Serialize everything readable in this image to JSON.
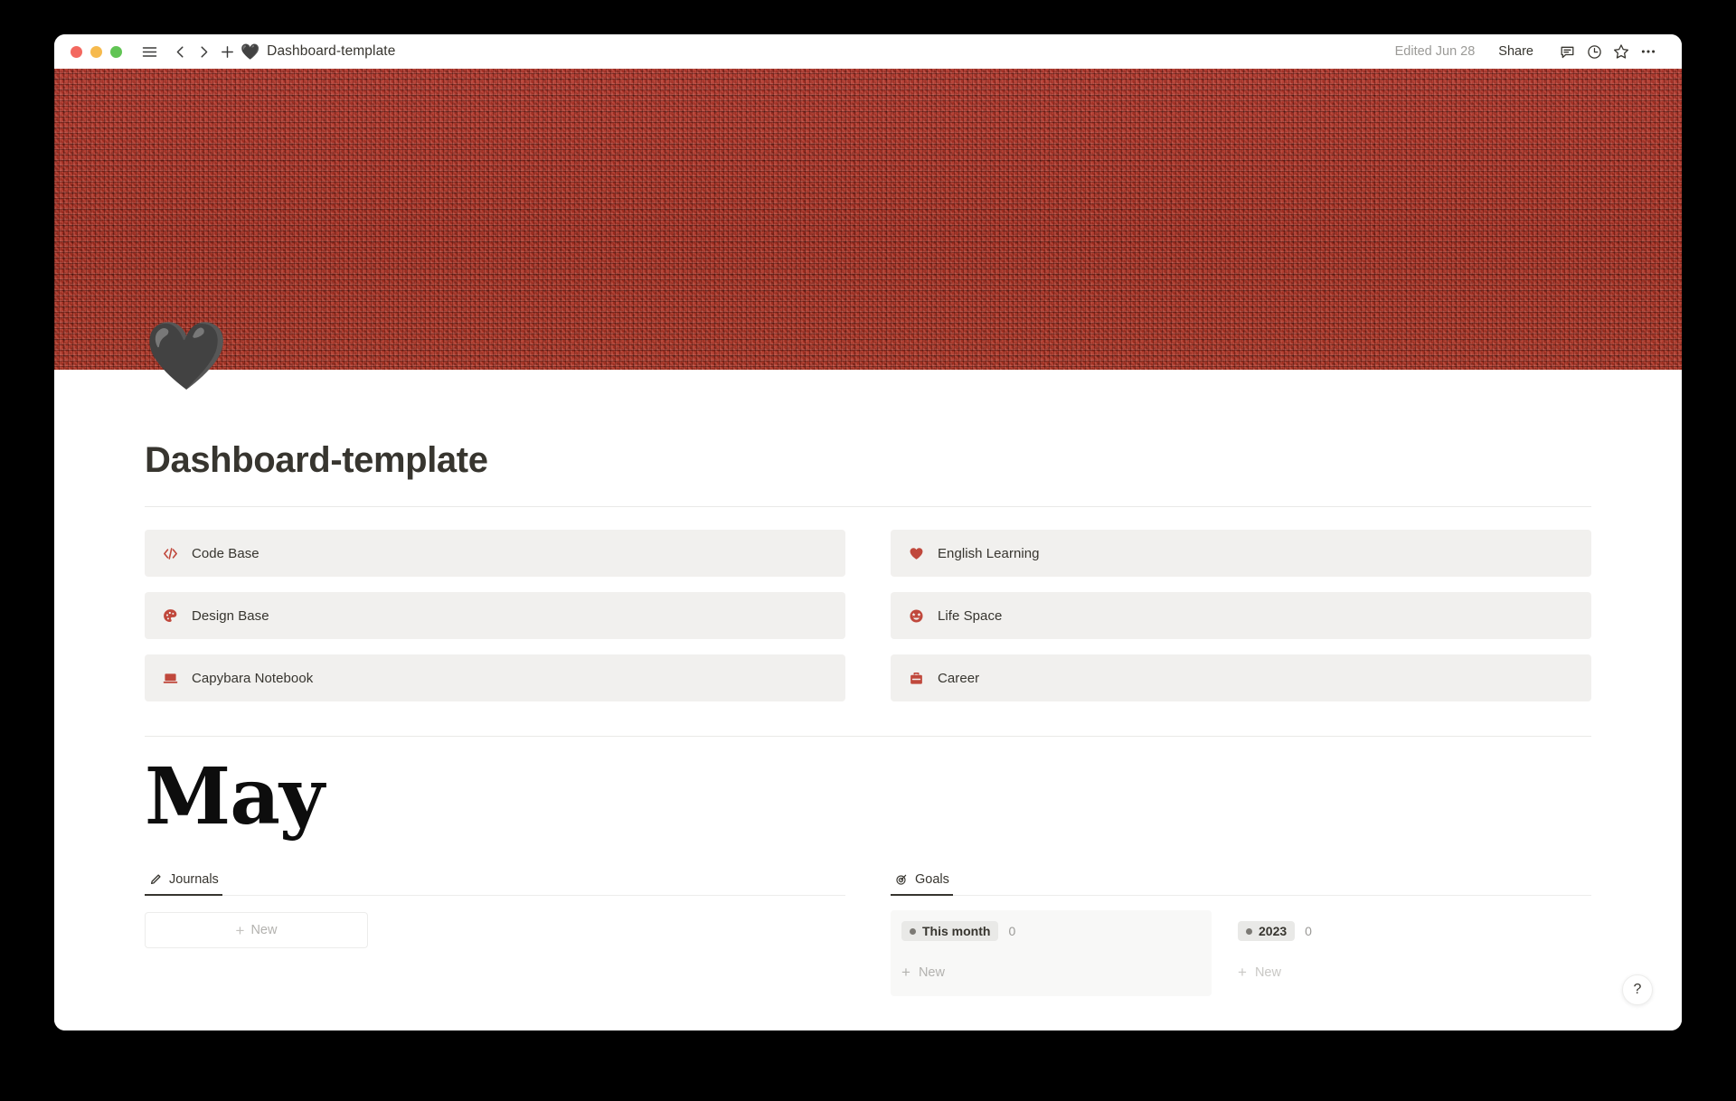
{
  "window": {
    "titlebar": {
      "traffic_lights": [
        "close",
        "minimize",
        "zoom"
      ],
      "sidebar_toggle": "hamburger-icon",
      "back": "chevron-left-icon",
      "forward": "chevron-right-icon",
      "new_page": "plus-icon",
      "doc_emoji": "🖤",
      "doc_title": "Dashboard-template",
      "edited": "Edited Jun 28",
      "share_label": "Share",
      "comment_icon": "comment-icon",
      "updates_icon": "clock-icon",
      "favorite_icon": "star-icon",
      "more_icon": "more-horizontal-icon"
    }
  },
  "cover": {
    "color": "#AE3223",
    "texture": "woven-red-fabric"
  },
  "page": {
    "emoji": "🖤",
    "title": "Dashboard-template"
  },
  "links": {
    "left": [
      {
        "icon": "code-icon",
        "label": "Code Base"
      },
      {
        "icon": "palette-icon",
        "label": "Design Base"
      },
      {
        "icon": "laptop-icon",
        "label": "Capybara Notebook"
      }
    ],
    "right": [
      {
        "icon": "heart-icon",
        "label": "English Learning"
      },
      {
        "icon": "star-struck-face-icon",
        "label": "Life Space"
      },
      {
        "icon": "briefcase-icon",
        "label": "Career"
      }
    ]
  },
  "month": {
    "name": "May"
  },
  "sections": {
    "journals": {
      "tab": {
        "icon": "pencil-icon",
        "label": "Journals",
        "active": true
      },
      "new_label": "New"
    },
    "goals": {
      "tab": {
        "icon": "target-icon",
        "label": "Goals",
        "active": true
      },
      "groups": [
        {
          "name": "This month",
          "count": "0",
          "new_label": "New",
          "shaded": true
        },
        {
          "name": "2023",
          "count": "0",
          "new_label": "New",
          "shaded": false
        }
      ]
    }
  },
  "help": {
    "label": "?"
  },
  "colors": {
    "accent_red": "#C0483C",
    "cover_red": "#AE3223",
    "card_bg": "#F1F0EE",
    "text": "#37352f",
    "muted": "#9b9a97"
  }
}
